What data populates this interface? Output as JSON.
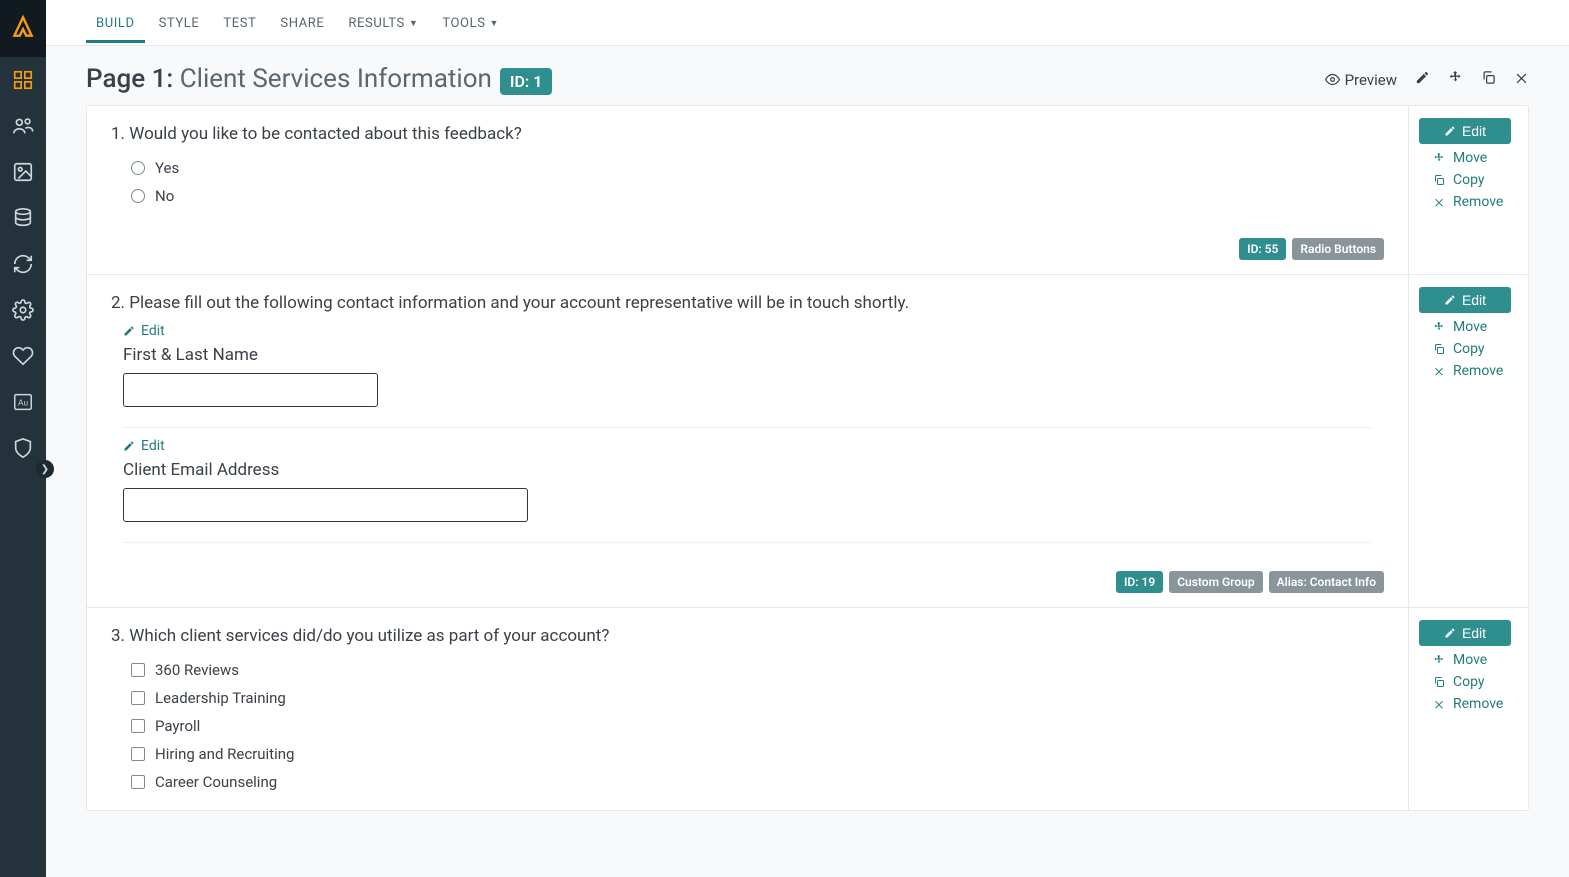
{
  "nav": {
    "tabs": [
      "BUILD",
      "STYLE",
      "TEST",
      "SHARE",
      "RESULTS",
      "TOOLS"
    ],
    "active_index": 0,
    "dropdown_indices": [
      4,
      5
    ]
  },
  "page": {
    "prefix": "Page 1:",
    "title": "Client Services Information",
    "id_badge": "ID: 1",
    "actions": {
      "preview": "Preview"
    }
  },
  "side_actions": {
    "edit": "Edit",
    "move": "Move",
    "copy": "Copy",
    "remove": "Remove"
  },
  "inline_edit": "Edit",
  "questions": [
    {
      "number": "1.",
      "text": "Would you like to be contacted about this feedback?",
      "type": "radio",
      "options": [
        "Yes",
        "No"
      ],
      "meta": {
        "id": "ID: 55",
        "type_label": "Radio Buttons"
      }
    },
    {
      "number": "2.",
      "text": "Please fill out the following contact information and your account representative will be in touch shortly.",
      "type": "custom_group",
      "fields": [
        {
          "label": "First & Last Name",
          "width": "w1"
        },
        {
          "label": "Client Email Address",
          "width": "w2"
        }
      ],
      "meta": {
        "id": "ID: 19",
        "type_label": "Custom Group",
        "alias": "Alias: Contact Info"
      }
    },
    {
      "number": "3.",
      "text": "Which client services did/do you utilize as part of your account?",
      "type": "checkbox",
      "options": [
        "360 Reviews",
        "Leadership Training",
        "Payroll",
        "Hiring and Recruiting",
        "Career Counseling"
      ]
    }
  ]
}
